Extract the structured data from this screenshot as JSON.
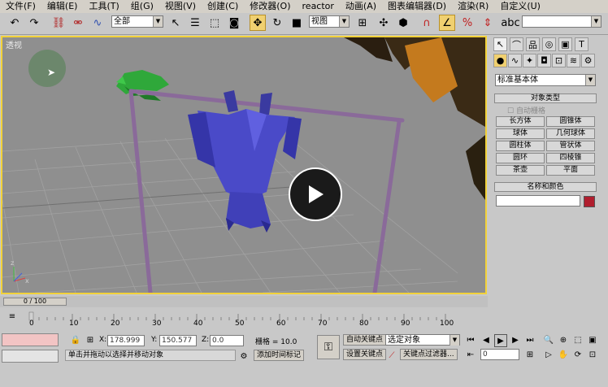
{
  "menu": [
    "文件(F)",
    "编辑(E)",
    "工具(T)",
    "组(G)",
    "视图(V)",
    "创建(C)",
    "修改器(O)",
    "reactor",
    "动画(A)",
    "图表编辑器(D)",
    "渲染(R)",
    "自定义(U)"
  ],
  "toolbar": {
    "selection_filter": "全部",
    "reference_coord": "视图",
    "named_selection": ""
  },
  "viewport": {
    "label": "透视",
    "play_button": "play-icon"
  },
  "panel": {
    "category": "标准基本体",
    "object_type_header": "对象类型",
    "autogrid_label": "自动栅格",
    "object_buttons": [
      "长方体",
      "圆锥体",
      "球体",
      "几何球体",
      "圆柱体",
      "管状体",
      "圆环",
      "四棱锥",
      "茶壶",
      "平面"
    ],
    "name_color_header": "名称和颜色",
    "name_value": "",
    "color": "#b01e2e"
  },
  "timeline": {
    "frame_display": "0 / 100",
    "ruler_labels": [
      "0",
      "10",
      "20",
      "30",
      "40",
      "50",
      "60",
      "70",
      "80",
      "90",
      "100"
    ]
  },
  "status": {
    "x_label": "X:",
    "x_value": "178.999",
    "y_label": "Y:",
    "y_value": "150.577",
    "z_label": "Z:",
    "z_value": "0.0",
    "grid_text": "栅格 = 10.0",
    "auto_key": "自动关键点",
    "set_key": "设置关键点",
    "selected_object": "选定对象",
    "key_filters": "关键点过滤器...",
    "prompt": "单击并拖动以选择并移动对象",
    "add_time_tag": "添加时间标记",
    "frame_value": "0"
  }
}
